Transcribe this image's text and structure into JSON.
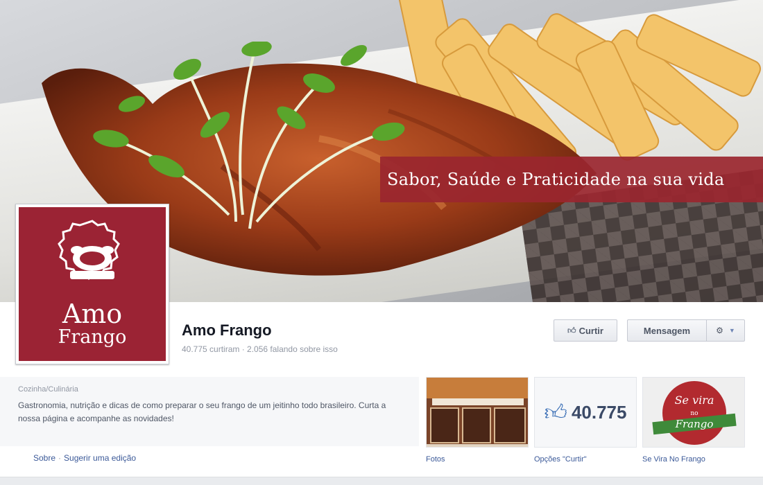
{
  "cover": {
    "tagline": "Sabor, Saúde e Praticidade na sua vida"
  },
  "profile": {
    "logo_line1": "Amo",
    "logo_line2": "Frango"
  },
  "page": {
    "name": "Amo Frango",
    "stats": "40.775 curtiram · 2.056 falando sobre isso"
  },
  "actions": {
    "like_label": "Curtir",
    "message_label": "Mensagem"
  },
  "about": {
    "category": "Cozinha/Culinária",
    "description": "Gastronomia, nutrição e dicas de como preparar o seu frango de um jeitinho todo brasileiro. Curta a nossa página e acompanhe as novidades!",
    "link_about": "Sobre",
    "link_separator": "·",
    "link_suggest": "Sugerir uma edição"
  },
  "apps": {
    "photos_label": "Fotos",
    "likes_count": "40.775",
    "likes_label": "Opções \"Curtir\"",
    "sevira_label": "Se Vira No Frango",
    "sevira_logo_line1": "Se vira",
    "sevira_logo_line2": "no",
    "sevira_logo_line3": "Frango"
  },
  "colors": {
    "brand_red": "#9b2334",
    "facebook_blue": "#3b5998",
    "link_blue": "#3b5998"
  },
  "icons": [
    "thumbs-up-icon",
    "gear-icon",
    "chevron-down-icon",
    "chicken-logo-icon"
  ]
}
